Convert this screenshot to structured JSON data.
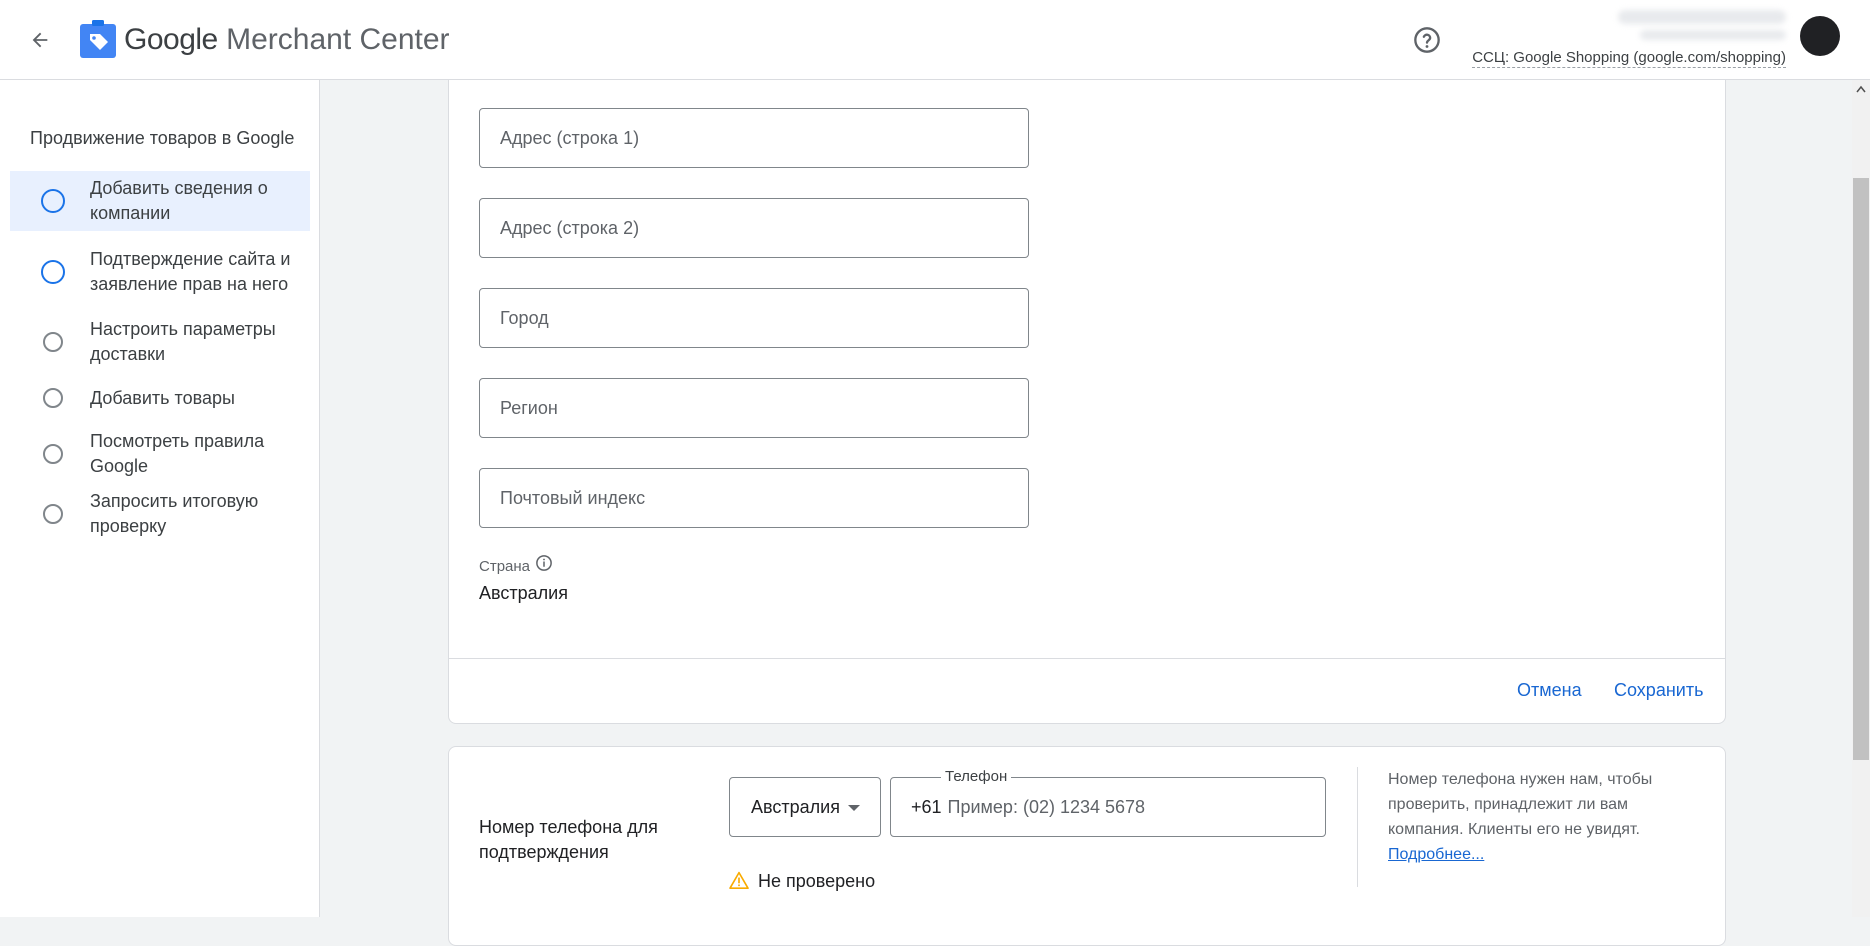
{
  "header": {
    "brand_google": "Google",
    "brand_product": "Merchant Center",
    "account_label": "ССЦ: Google Shopping (google.com/shopping)",
    "icons": {
      "back": "arrow-back-icon",
      "help": "help-circle-icon",
      "logo": "merchant-center-logo"
    }
  },
  "sidebar": {
    "title": "Продвижение товаров в Google",
    "steps": [
      {
        "label": "Добавить сведения о компании",
        "active": true
      },
      {
        "label": "Подтверждение сайта и заявление прав на него",
        "active": false
      },
      {
        "label": "Настроить параметры доставки",
        "active": false
      },
      {
        "label": "Добавить товары",
        "active": false
      },
      {
        "label": "Посмотреть правила Google",
        "active": false
      },
      {
        "label": "Запросить итоговую проверку",
        "active": false
      }
    ]
  },
  "address_form": {
    "fields": {
      "address1": {
        "placeholder": "Адрес (строка 1)",
        "value": ""
      },
      "address2": {
        "placeholder": "Адрес (строка 2)",
        "value": ""
      },
      "city": {
        "placeholder": "Город",
        "value": ""
      },
      "region": {
        "placeholder": "Регион",
        "value": ""
      },
      "postal": {
        "placeholder": "Почтовый индекс",
        "value": ""
      }
    },
    "country_label": "Страна",
    "country_value": "Австралия",
    "cancel_label": "Отмена",
    "save_label": "Сохранить"
  },
  "phone": {
    "title": "Номер телефона для подтверждения",
    "country_selected": "Австралия",
    "field_label": "Телефон",
    "prefix": "+61",
    "placeholder": "Пример: (02) 1234 5678",
    "status": "Не проверено",
    "hint": "Номер телефона нужен нам, чтобы проверить, принадлежит ли вам компания. Клиенты его не увидят.",
    "learn_more": "Подробнее..."
  },
  "colors": {
    "accent": "#1a73e8",
    "link": "#1967d2",
    "active_bg": "#e8f0fe",
    "warning": "#f9ab00"
  }
}
